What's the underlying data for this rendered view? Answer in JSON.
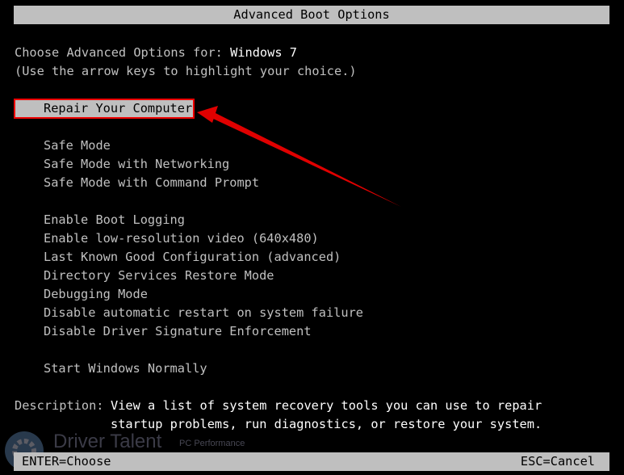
{
  "title": "Advanced Boot Options",
  "prompt": {
    "label": "Choose Advanced Options for: ",
    "os": "Windows 7",
    "hint": "(Use the arrow keys to highlight your choice.)"
  },
  "selected": "Repair Your Computer",
  "groups": [
    [
      "Safe Mode",
      "Safe Mode with Networking",
      "Safe Mode with Command Prompt"
    ],
    [
      "Enable Boot Logging",
      "Enable low-resolution video (640x480)",
      "Last Known Good Configuration (advanced)",
      "Directory Services Restore Mode",
      "Debugging Mode",
      "Disable automatic restart on system failure",
      "Disable Driver Signature Enforcement"
    ],
    [
      "Start Windows Normally"
    ]
  ],
  "description": {
    "label": "Description:",
    "line1": "View a list of system recovery tools you can use to repair",
    "line2": "startup problems, run diagnostics, or restore your system."
  },
  "footer": {
    "enter": "ENTER=Choose",
    "esc": "ESC=Cancel"
  },
  "watermark": {
    "name": "Driver Talent",
    "tagline": "PC Performance"
  },
  "colors": {
    "highlight_border": "#e00000",
    "arrow": "#e00000",
    "bar": "#bfbfbf"
  }
}
